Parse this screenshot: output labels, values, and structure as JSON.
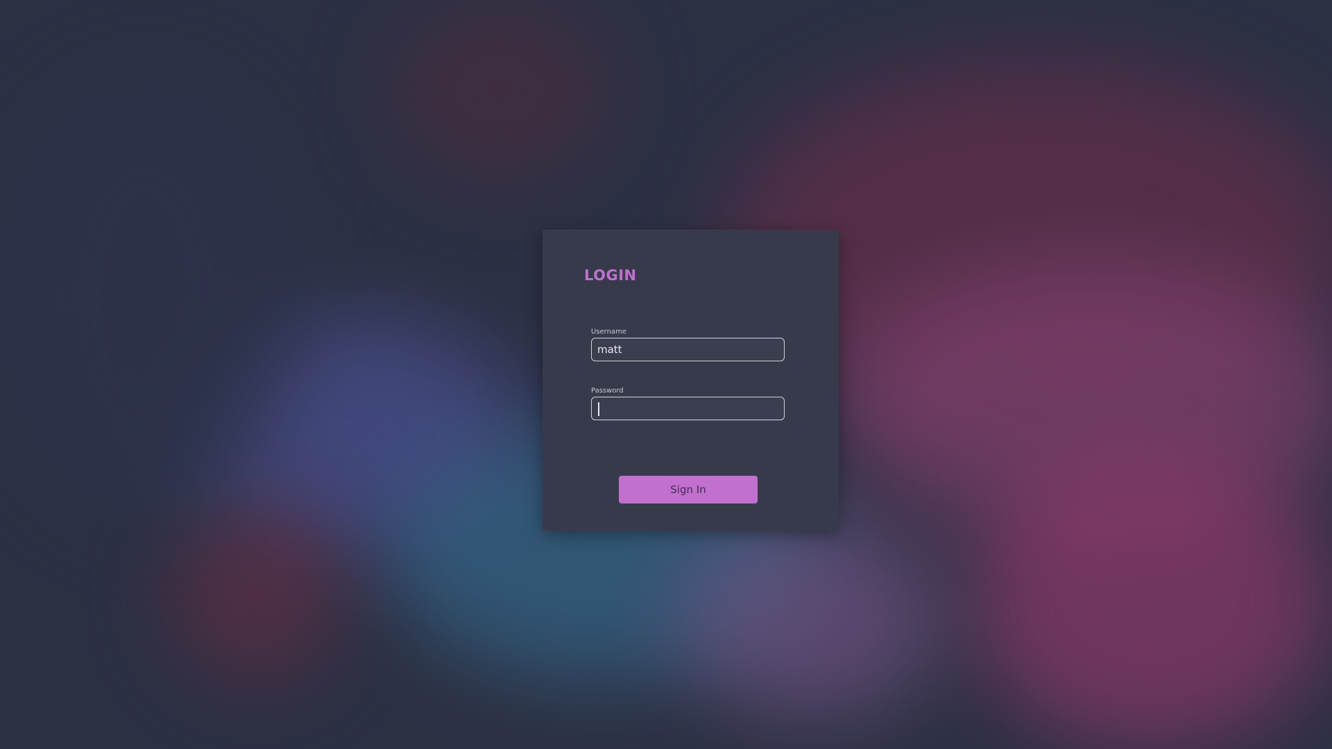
{
  "background": {
    "description_icon": "retro-game-consoles-background",
    "tint_color": "#2e3346"
  },
  "login": {
    "title": "LOGIN",
    "username_label": "Username",
    "username_value": "matt",
    "password_label": "Password",
    "password_value": "",
    "signin_label": "Sign In"
  },
  "colors": {
    "accent": "#c270d0",
    "panel": "#363a4b",
    "input_border": "#d4d5dc"
  }
}
